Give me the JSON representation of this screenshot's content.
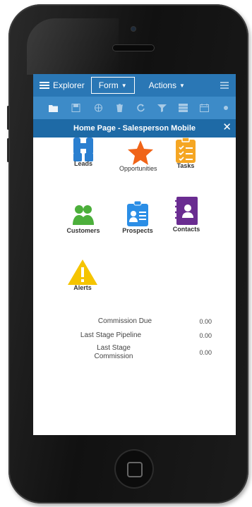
{
  "topbar": {
    "explorer_label": "Explorer",
    "form_label": "Form",
    "actions_label": "Actions"
  },
  "toolbar_icons": [
    "folder-icon",
    "save-icon",
    "globe-icon",
    "trash-icon",
    "refresh-icon",
    "filter-icon",
    "grid-icon",
    "calendar-icon"
  ],
  "titlebar": {
    "title": "Home Page - Salesperson Mobile"
  },
  "tiles": [
    {
      "label": "Leads",
      "icon": "binoculars-icon",
      "color": "#2a7fd0"
    },
    {
      "label": "Opportunities",
      "icon": "star-icon",
      "color": "#f06418"
    },
    {
      "label": "Tasks",
      "icon": "checklist-icon",
      "color": "#f5a623"
    },
    {
      "label": "Customers",
      "icon": "people-icon",
      "color": "#4caf3b"
    },
    {
      "label": "Prospects",
      "icon": "id-card-icon",
      "color": "#2b8ee6"
    },
    {
      "label": "Contacts",
      "icon": "contact-book-icon",
      "color": "#6a2c91"
    },
    {
      "label": "Alerts",
      "icon": "warning-icon",
      "color": "#f5c400"
    }
  ],
  "stats": [
    {
      "label": "Commission Due",
      "value": "0.00"
    },
    {
      "label": "Last Stage Pipeline",
      "value": "0.00"
    },
    {
      "label_line1": "Last Stage",
      "label_line2": "Commission",
      "value": "0.00"
    }
  ],
  "colors": {
    "topbar": "#2a77b5",
    "toolbar": "#3d8bc8",
    "titlebar": "#1e6aa6"
  }
}
